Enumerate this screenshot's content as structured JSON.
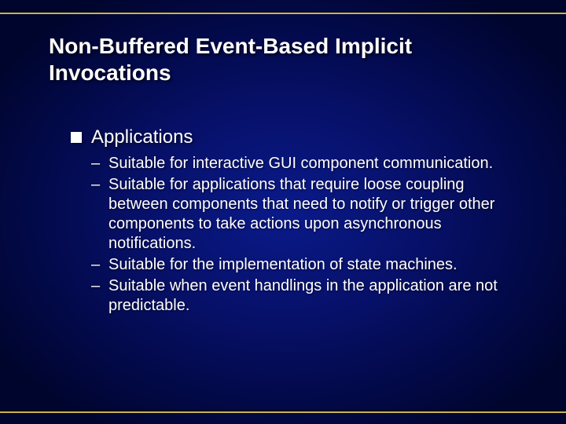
{
  "title": "Non-Buffered Event-Based Implicit Invocations",
  "body": {
    "heading": "Applications",
    "items": [
      "Suitable for interactive GUI component communication.",
      "Suitable for applications that require loose coupling between components that need to notify or trigger other components to take actions upon asynchronous notifications.",
      "Suitable for the implementation of state machines.",
      "Suitable when event handlings in the application are not predictable."
    ]
  },
  "bullet_dash": "–"
}
